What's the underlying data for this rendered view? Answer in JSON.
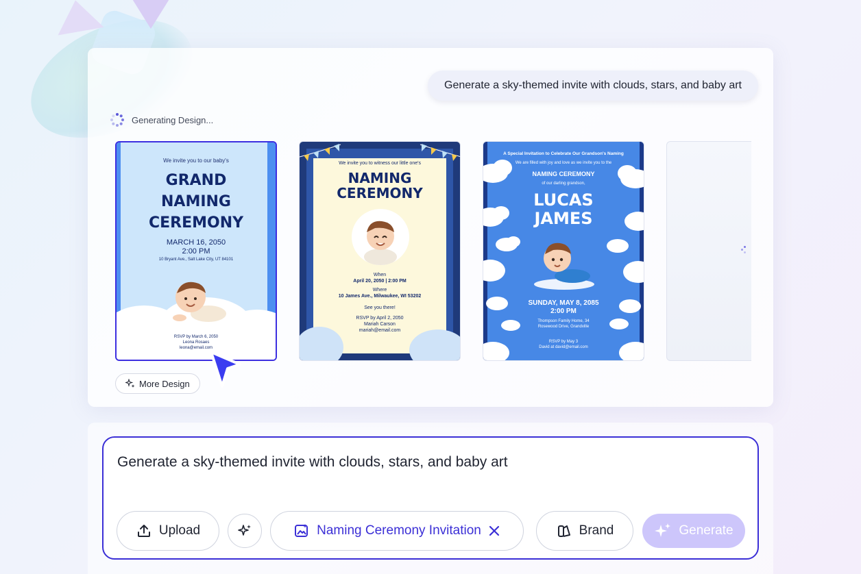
{
  "prompt_bubble": "Generate a sky-themed invite with clouds, stars, and baby art",
  "status": "Generating Design...",
  "more_design": "More Design",
  "card1": {
    "intro": "We invite you to our baby's",
    "title_lines": [
      "GRAND",
      "NAMING",
      "CEREMONY"
    ],
    "date": "MARCH 16, 2050",
    "time": "2:00 PM",
    "address": "10 Bryant Ave., Salt Lake City, UT 84101",
    "rsvp": "RSVP by March 6, 2050",
    "contact_name": "Leona Rosaes",
    "contact_email": "leona@email.com"
  },
  "card2": {
    "intro": "We invite you to witness our little one's",
    "title_lines": [
      "NAMING",
      "CEREMONY"
    ],
    "when_label": "When",
    "when": "April 20, 2050 | 2:00 PM",
    "where_label": "Where",
    "where": "10 James Ave., Milwaukee, WI 53202",
    "see_you": "See you there!",
    "rsvp": "RSVP by April 2, 2050",
    "contact_name": "Mariah Carson",
    "contact_email": "mariah@email.com"
  },
  "card3": {
    "top": "A Special Invitation to Celebrate Our Grandson's Naming",
    "filled": "We are filled with joy and love as we invite you to the",
    "ceremony": "NAMING CEREMONY",
    "of_our": "of our darling grandson,",
    "name_lines": [
      "LUCAS",
      "JAMES"
    ],
    "date": "SUNDAY, MAY 8, 2085",
    "time": "2:00 PM",
    "venue_lines": [
      "Thompson Family Home, 34",
      "Rosewood Drive, Grandville"
    ],
    "rsvp": "RSVP by May 3",
    "contact": "David at david@email.com"
  },
  "composer": {
    "text": "Generate a sky-themed invite with clouds, stars, and baby art",
    "upload": "Upload",
    "template": "Naming Ceremony Invitation",
    "brand": "Brand",
    "generate": "Generate"
  },
  "colors": {
    "accent": "#3b2fd6",
    "generate_disabled": "#cdc6fb"
  }
}
